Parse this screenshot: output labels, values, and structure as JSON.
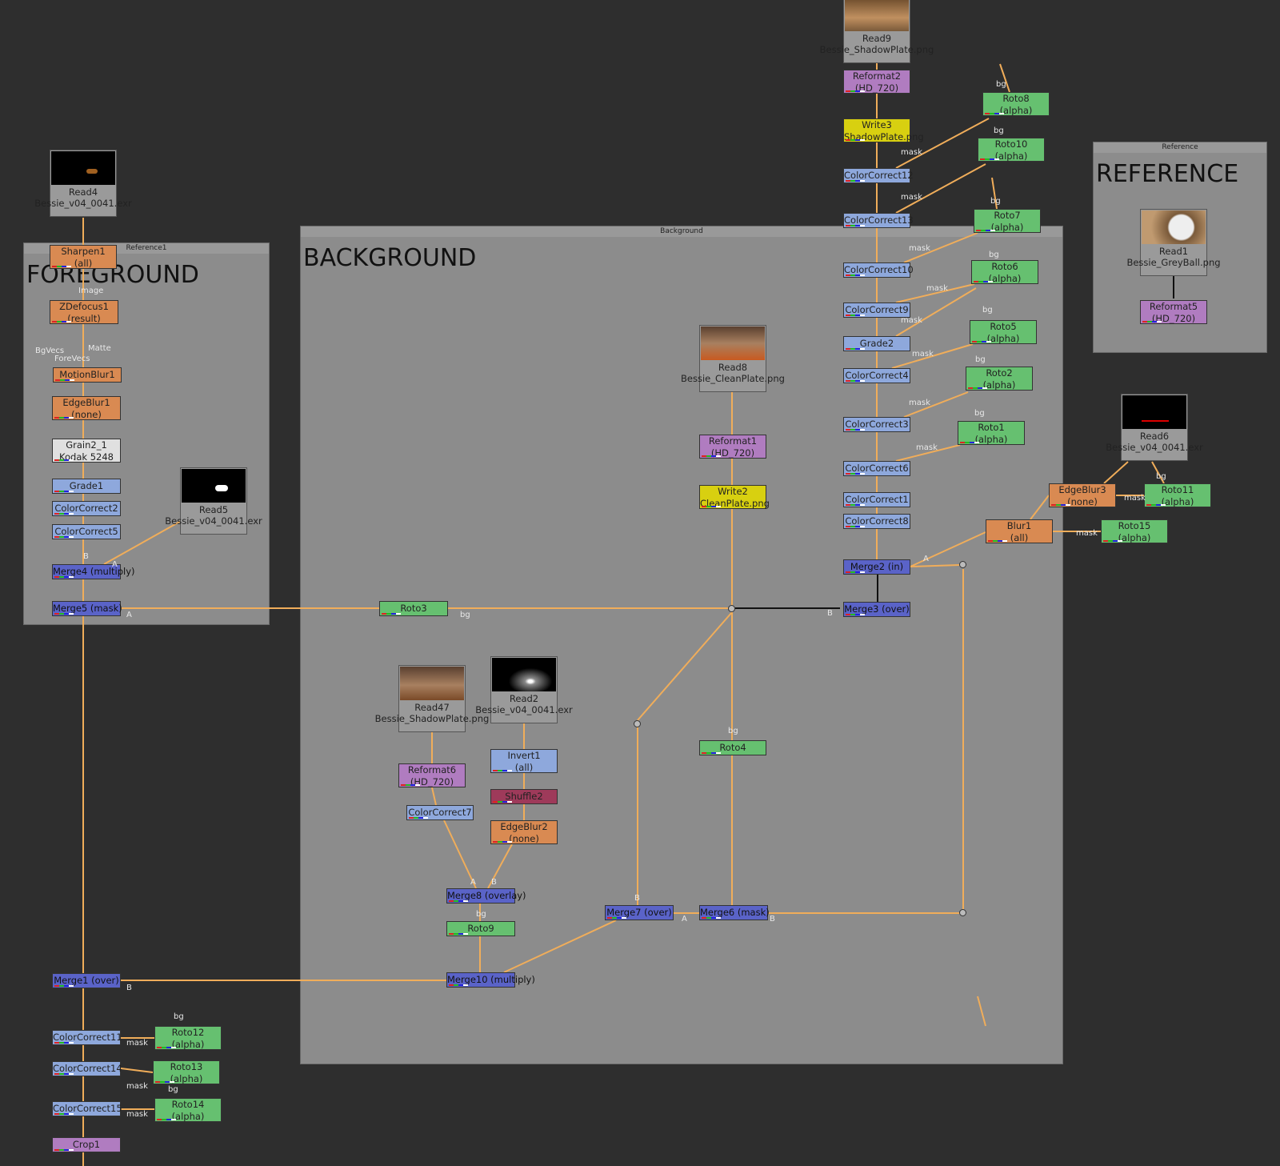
{
  "backdrops": {
    "reference1": {
      "title": "Reference1",
      "heading": "FOREGROUND"
    },
    "background": {
      "title": "Background",
      "heading": "BACKGROUND"
    },
    "reference": {
      "title": "Reference",
      "heading": "REFERENCE"
    }
  },
  "reads": {
    "read4": {
      "name": "Read4",
      "file": "Bessie_v04_0041.exr"
    },
    "read5": {
      "name": "Read5",
      "file": "Bessie_v04_0041.exr"
    },
    "read9": {
      "name": "Read9",
      "file": "Bessie_ShadowPlate.png"
    },
    "read8": {
      "name": "Read8",
      "file": "Bessie_CleanPlate.png"
    },
    "read47": {
      "name": "Read47",
      "file": "Bessie_ShadowPlate.png"
    },
    "read2": {
      "name": "Read2",
      "file": "Bessie_v04_0041.exr"
    },
    "read1": {
      "name": "Read1",
      "file": "Bessie_GreyBall.png"
    },
    "read6": {
      "name": "Read6",
      "file": "Bessie_v04_0041.exr"
    }
  },
  "nodes": {
    "sharpen1": [
      "Sharpen1",
      "(all)"
    ],
    "zdefocus1": [
      "ZDefocus1",
      "(result)"
    ],
    "motionblur1": [
      "MotionBlur1"
    ],
    "edgeblur1": [
      "EdgeBlur1",
      "(none)"
    ],
    "grain2_1": [
      "Grain2_1",
      "Kodak 5248"
    ],
    "grade1": [
      "Grade1"
    ],
    "colorcorrect2": [
      "ColorCorrect2"
    ],
    "colorcorrect5": [
      "ColorCorrect5"
    ],
    "merge4": [
      "Merge4 (multiply)"
    ],
    "merge5": [
      "Merge5 (mask)"
    ],
    "roto3": [
      "Roto3"
    ],
    "reformat2": [
      "Reformat2",
      "(HD_720)"
    ],
    "write3": [
      "Write3",
      "ShadowPlate.png"
    ],
    "colorcorrect12": [
      "ColorCorrect12"
    ],
    "colorcorrect13": [
      "ColorCorrect13"
    ],
    "colorcorrect10": [
      "ColorCorrect10"
    ],
    "colorcorrect9": [
      "ColorCorrect9"
    ],
    "grade2": [
      "Grade2"
    ],
    "colorcorrect4": [
      "ColorCorrect4"
    ],
    "colorcorrect3": [
      "ColorCorrect3"
    ],
    "colorcorrect6": [
      "ColorCorrect6"
    ],
    "colorcorrect1": [
      "ColorCorrect1"
    ],
    "colorcorrect8": [
      "ColorCorrect8"
    ],
    "merge2": [
      "Merge2 (in)"
    ],
    "merge3": [
      "Merge3 (over)"
    ],
    "roto8": [
      "Roto8",
      "(alpha)"
    ],
    "roto10": [
      "Roto10",
      "(alpha)"
    ],
    "roto7": [
      "Roto7",
      "(alpha)"
    ],
    "roto6": [
      "Roto6",
      "(alpha)"
    ],
    "roto5": [
      "Roto5",
      "(alpha)"
    ],
    "roto2": [
      "Roto2",
      "(alpha)"
    ],
    "roto1": [
      "Roto1",
      "(alpha)"
    ],
    "reformat1": [
      "Reformat1",
      "(HD_720)"
    ],
    "write2": [
      "Write2",
      "CleanPlate.png"
    ],
    "reformat6": [
      "Reformat6",
      "(HD_720)"
    ],
    "colorcorrect7": [
      "ColorCorrect7"
    ],
    "invert1": [
      "Invert1",
      "(all)"
    ],
    "shuffle2": [
      "Shuffle2"
    ],
    "edgeblur2": [
      "EdgeBlur2",
      "(none)"
    ],
    "merge8": [
      "Merge8 (overlay)"
    ],
    "roto9": [
      "Roto9"
    ],
    "merge10": [
      "Merge10 (multiply)"
    ],
    "merge7": [
      "Merge7 (over)"
    ],
    "merge6": [
      "Merge6 (mask)"
    ],
    "roto4": [
      "Roto4"
    ],
    "merge1": [
      "Merge1 (over)"
    ],
    "colorcorrect11": [
      "ColorCorrect11"
    ],
    "colorcorrect14": [
      "ColorCorrect14"
    ],
    "colorcorrect15": [
      "ColorCorrect15"
    ],
    "crop1": [
      "Crop1"
    ],
    "roto12": [
      "Roto12",
      "(alpha)"
    ],
    "roto13": [
      "Roto13",
      "(alpha)"
    ],
    "roto14": [
      "Roto14",
      "(alpha)"
    ],
    "edgeblur3": [
      "EdgeBlur3",
      "(none)"
    ],
    "roto11": [
      "Roto11",
      "(alpha)"
    ],
    "blur1": [
      "Blur1",
      "(all)"
    ],
    "roto15": [
      "Roto15",
      "(alpha)"
    ],
    "reformat5": [
      "Reformat5",
      "(HD_720)"
    ]
  },
  "labels": {
    "mask": "mask",
    "bg": "bg",
    "a": "A",
    "b": "B",
    "image": "Image",
    "matte": "Matte",
    "bgvecs": "BgVecs",
    "forevecs": "ForeVecs"
  },
  "colors": {
    "canvas": "#2e2e2e",
    "backdrop": "#8c8c8c",
    "wire": "#f0ad5a",
    "merge": "#5a63c8",
    "colorcorrect": "#8ea8dc",
    "roto": "#66c070",
    "filter": "#d98a52",
    "reformat": "#b07cc0",
    "write": "#d8d010",
    "shuffle": "#9e3a5a",
    "grain": "#e0e0e0"
  }
}
